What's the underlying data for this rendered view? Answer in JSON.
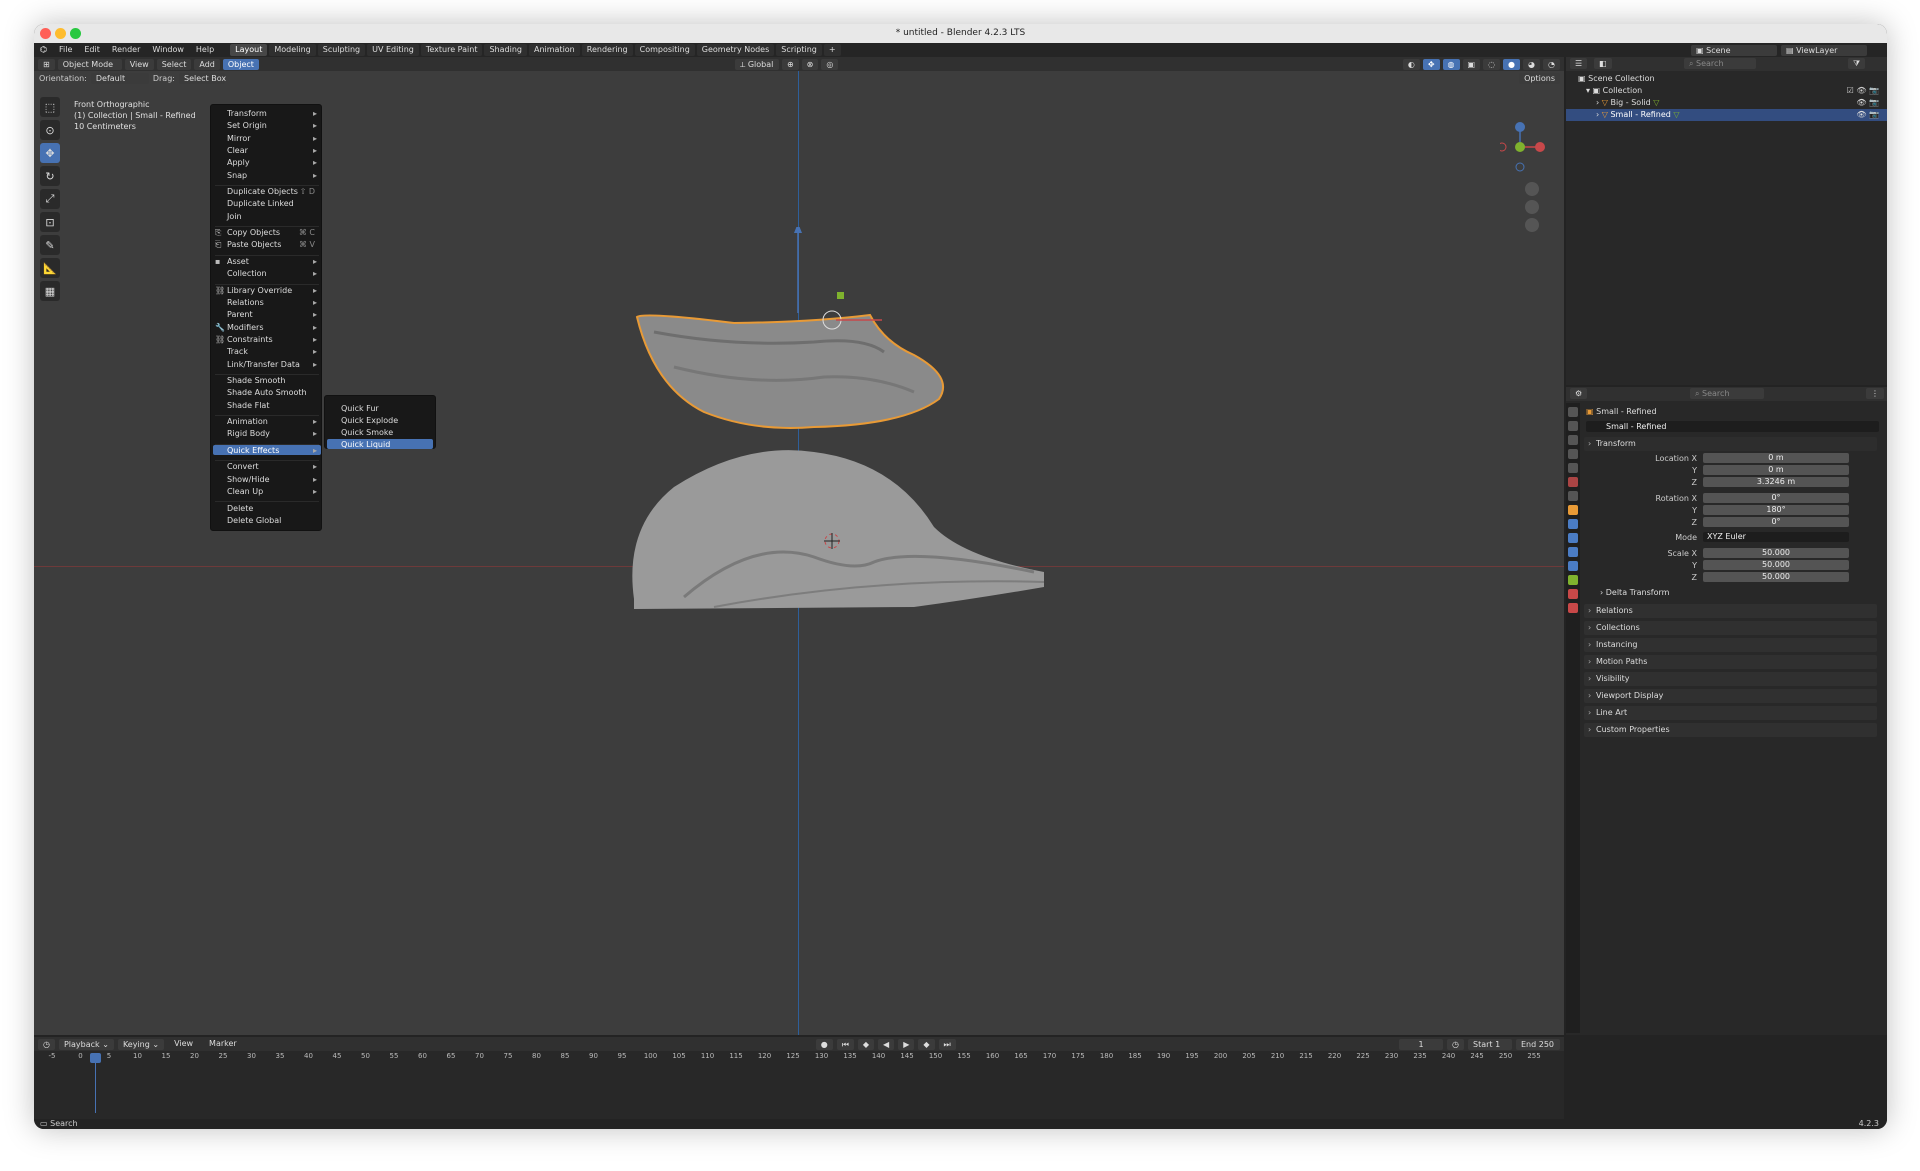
{
  "window": {
    "title": "* untitled - Blender 4.2.3 LTS"
  },
  "menubar": {
    "items": [
      "File",
      "Edit",
      "Render",
      "Window",
      "Help"
    ]
  },
  "workspaces": [
    "Layout",
    "Modeling",
    "Sculpting",
    "UV Editing",
    "Texture Paint",
    "Shading",
    "Animation",
    "Rendering",
    "Compositing",
    "Geometry Nodes",
    "Scripting"
  ],
  "topright": {
    "scene": "Scene",
    "viewlayer": "ViewLayer"
  },
  "viewport": {
    "mode": "Object Mode",
    "menus": [
      "View",
      "Select",
      "Add",
      "Object"
    ],
    "orientation_label": "Orientation:",
    "orientation_value": "Default",
    "drag_label": "Drag:",
    "drag_value": "Select Box",
    "transform_orientation": "Global",
    "options": "Options",
    "info": [
      "Front Orthographic",
      "(1) Collection | Small - Refined",
      "10 Centimeters"
    ]
  },
  "object_menu": {
    "items": [
      {
        "label": "Transform",
        "sub": true
      },
      {
        "label": "Set Origin",
        "sub": true
      },
      {
        "label": "Mirror",
        "sub": true
      },
      {
        "label": "Clear",
        "sub": true
      },
      {
        "label": "Apply",
        "sub": true
      },
      {
        "label": "Snap",
        "sub": true
      },
      {
        "label": "Duplicate Objects",
        "shortcut": "⇧ D"
      },
      {
        "label": "Duplicate Linked"
      },
      {
        "label": "Join"
      },
      {
        "label": "Copy Objects",
        "shortcut": "⌘ C"
      },
      {
        "label": "Paste Objects",
        "shortcut": "⌘ V"
      },
      {
        "label": "Asset",
        "sub": true
      },
      {
        "label": "Collection",
        "sub": true
      },
      {
        "label": "Library Override",
        "sub": true
      },
      {
        "label": "Relations",
        "sub": true
      },
      {
        "label": "Parent",
        "sub": true
      },
      {
        "label": "Modifiers",
        "sub": true
      },
      {
        "label": "Constraints",
        "sub": true
      },
      {
        "label": "Track",
        "sub": true
      },
      {
        "label": "Link/Transfer Data",
        "sub": true
      },
      {
        "label": "Shade Smooth"
      },
      {
        "label": "Shade Auto Smooth"
      },
      {
        "label": "Shade Flat"
      },
      {
        "label": "Animation",
        "sub": true
      },
      {
        "label": "Rigid Body",
        "sub": true
      },
      {
        "label": "Quick Effects",
        "sub": true
      },
      {
        "label": "Convert",
        "sub": true
      },
      {
        "label": "Show/Hide",
        "sub": true
      },
      {
        "label": "Clean Up",
        "sub": true
      },
      {
        "label": "Delete"
      },
      {
        "label": "Delete Global"
      }
    ]
  },
  "quick_effects": [
    "Quick Fur",
    "Quick Explode",
    "Quick Smoke",
    "Quick Liquid"
  ],
  "outliner": {
    "search_placeholder": "Search",
    "scene_collection": "Scene Collection",
    "collection": "Collection",
    "objects": [
      "Big - Solid",
      "Small - Refined"
    ]
  },
  "properties": {
    "search_placeholder": "Search",
    "object_name": "Small - Refined",
    "object_field": "Small - Refined",
    "transform_header": "Transform",
    "location_label": "Location X",
    "location": [
      "0 m",
      "0 m",
      "3.3246 m"
    ],
    "rotation_label": "Rotation X",
    "rotation": [
      "0°",
      "180°",
      "0°"
    ],
    "mode_label": "Mode",
    "mode_value": "XYZ Euler",
    "scale_label": "Scale X",
    "scale": [
      "50.000",
      "50.000",
      "50.000"
    ],
    "axis_y": "Y",
    "axis_z": "Z",
    "delta": "Delta Transform",
    "sections": [
      "Relations",
      "Collections",
      "Instancing",
      "Motion Paths",
      "Visibility",
      "Viewport Display",
      "Line Art",
      "Custom Properties"
    ]
  },
  "timeline": {
    "playback": "Playback",
    "keying": "Keying",
    "view": "View",
    "marker": "Marker",
    "current_frame": "1",
    "start_label": "Start",
    "start": "1",
    "end_label": "End",
    "end": "250",
    "ticks": [
      "-5",
      "0",
      "5",
      "10",
      "15",
      "20",
      "25",
      "30",
      "35",
      "40",
      "45",
      "50",
      "55",
      "60",
      "65",
      "70",
      "75",
      "80",
      "85",
      "90",
      "95",
      "100",
      "105",
      "110",
      "115",
      "120",
      "125",
      "130",
      "135",
      "140",
      "145",
      "150",
      "155",
      "160",
      "165",
      "170",
      "175",
      "180",
      "185",
      "190",
      "195",
      "200",
      "205",
      "210",
      "215",
      "220",
      "225",
      "230",
      "235",
      "240",
      "245",
      "250",
      "255"
    ]
  },
  "statusbar": {
    "search": "Search",
    "version": "4.2.3"
  }
}
